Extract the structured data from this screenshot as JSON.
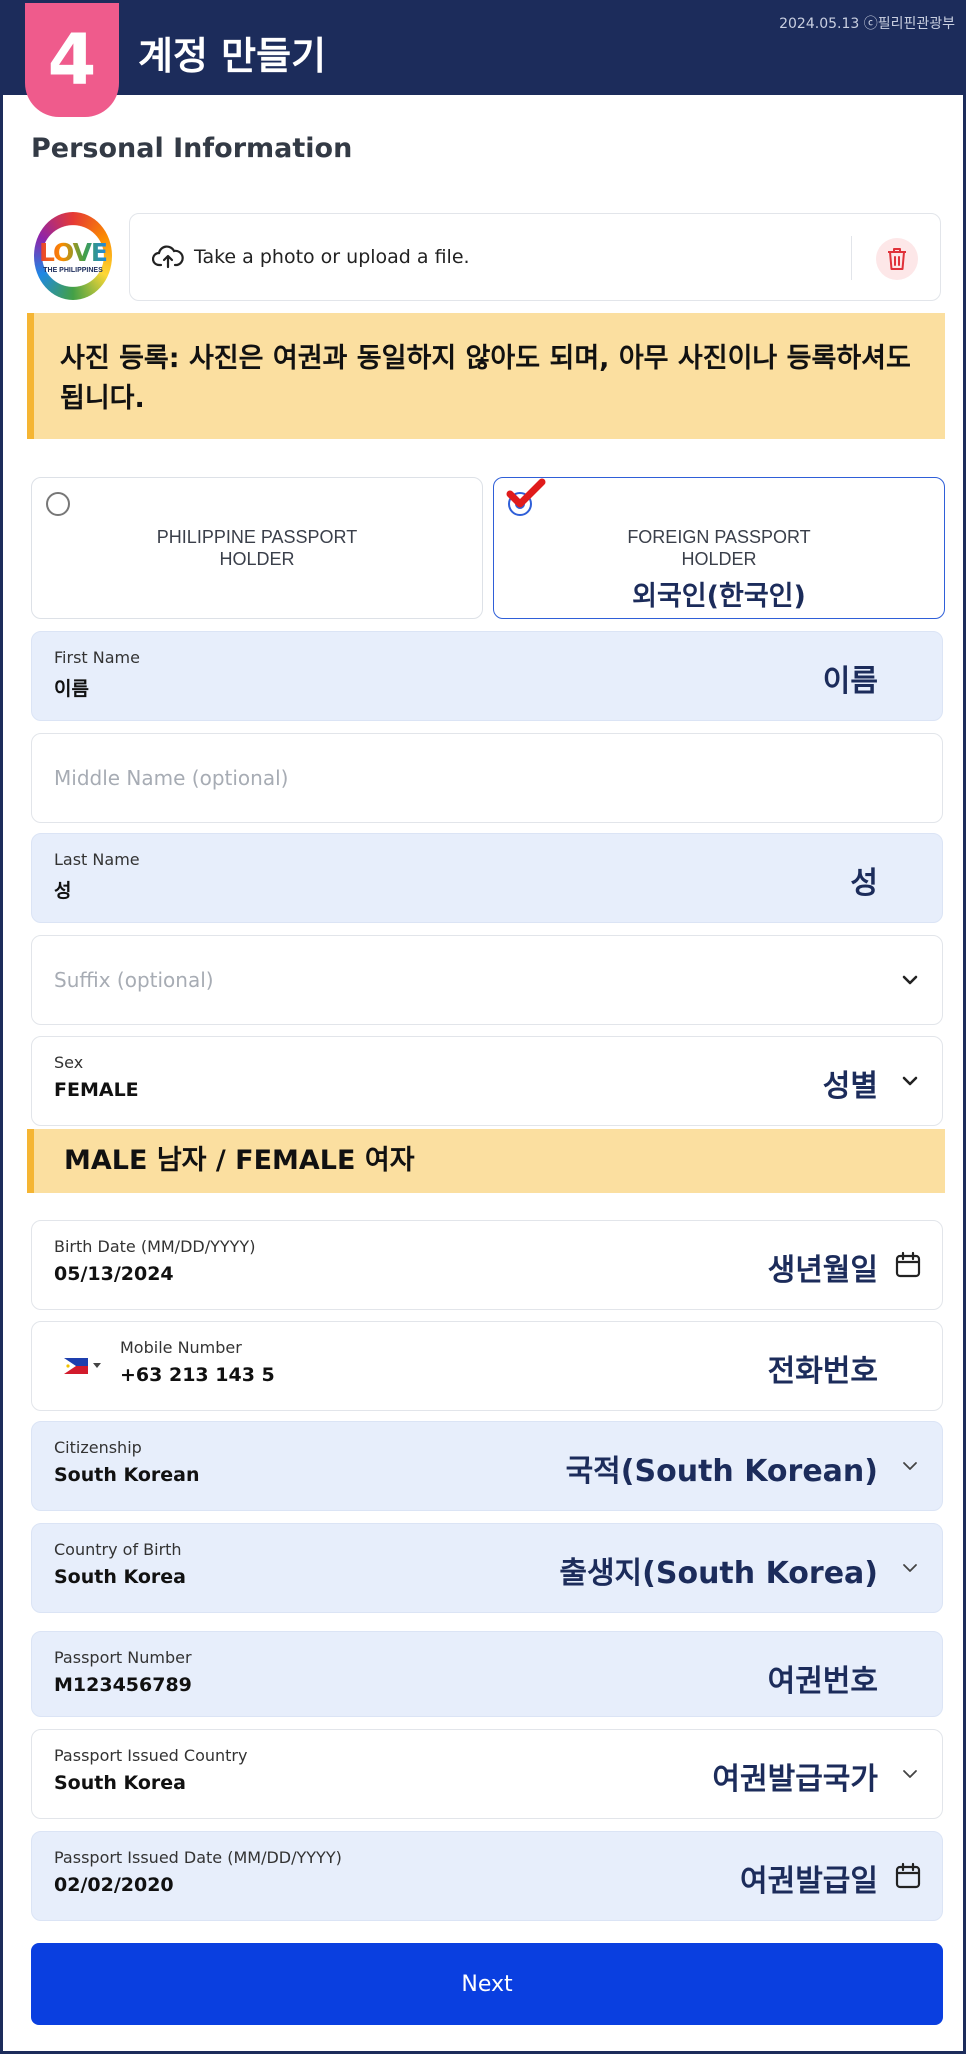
{
  "header": {
    "step_number": "4",
    "title": "계정 만들기",
    "credit": "2024.05.13 ⓒ필리핀관광부"
  },
  "section_title": "Personal Information",
  "photo": {
    "avatar_text": "LOVE",
    "avatar_subtext": "THE PHILIPPINES",
    "upload_label": "Take a photo or upload a file."
  },
  "notes": {
    "photo_note": "사진 등록: 사진은 여권과 동일하지 않아도 되며, 아무 사진이나 등록하셔도 됩니다.",
    "sex_note": "MALE 남자 / FEMALE 여자"
  },
  "holder_options": [
    {
      "label": "PHILIPPINE PASSPORT\nHOLDER",
      "selected": false,
      "annotation": ""
    },
    {
      "label": "FOREIGN PASSPORT\nHOLDER",
      "selected": true,
      "annotation": "외국인(한국인)"
    }
  ],
  "fields": {
    "first_name": {
      "label": "First Name",
      "value": "이름",
      "annotation": "이름"
    },
    "middle_name": {
      "placeholder": "Middle Name (optional)"
    },
    "last_name": {
      "label": "Last Name",
      "value": "성",
      "annotation": "성"
    },
    "suffix": {
      "placeholder": "Suffix (optional)"
    },
    "sex": {
      "label": "Sex",
      "value": "FEMALE",
      "annotation": "성별"
    },
    "birth_date": {
      "label": "Birth Date (MM/DD/YYYY)",
      "value": "05/13/2024",
      "annotation": "생년월일"
    },
    "mobile": {
      "label": "Mobile Number",
      "value": "+63 213 143 5",
      "annotation": "전화번호"
    },
    "citizenship": {
      "label": "Citizenship",
      "value": "South Korean",
      "annotation": "국적(South Korean)"
    },
    "country_of_birth": {
      "label": "Country of Birth",
      "value": "South Korea",
      "annotation": "출생지(South Korea)"
    },
    "passport_number": {
      "label": "Passport Number",
      "value": "M123456789",
      "annotation": "여권번호"
    },
    "passport_issued_country": {
      "label": "Passport Issued Country",
      "value": "South Korea",
      "annotation": "여권발급국가"
    },
    "passport_issued_date": {
      "label": "Passport Issued Date (MM/DD/YYYY)",
      "value": "02/02/2020",
      "annotation": "여권발급일"
    }
  },
  "next_button": "Next",
  "colors": {
    "header_navy": "#1c2c5b",
    "step_pink": "#ef5b8c",
    "note_yellow": "#fbdfa0",
    "filled_field": "#e7eefb",
    "primary_blue": "#0a3fe0",
    "check_red": "#e01b1b"
  },
  "icons": {
    "upload": "upload-cloud-icon",
    "delete": "trash-icon",
    "dropdown": "chevron-down-icon",
    "calendar": "calendar-icon",
    "flag": "philippines-flag-icon",
    "check": "checkmark-icon"
  }
}
